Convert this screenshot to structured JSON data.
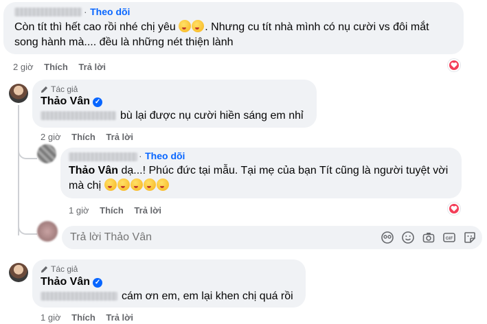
{
  "comment1": {
    "follow_label": "Theo dõi",
    "line1": "Còn tít thì hết cao rồi nhé chị yêu",
    "line1_tail": "Nhưng cu tít nhà mình có nụ cười vs đôi mắt",
    "line2": "song hành mà.... đều là những nét thiện lành",
    "time": "2 giờ",
    "like": "Thích",
    "reply": "Trả lời"
  },
  "comment2": {
    "author_badge": "Tác giả",
    "name": "Thảo Vân",
    "text": "bù lại được nụ cười hiền sáng em nhỉ",
    "time": "2 giờ",
    "like": "Thích",
    "reply": "Trả lời"
  },
  "comment3": {
    "follow_label": "Theo dõi",
    "mention": "Thảo Vân",
    "line1": "dạ...! Phúc đức tại mẫu. Tại mẹ của bạn Tít cũng là người tuyệt vời",
    "line2": "mà chị",
    "time": "1 giờ",
    "like": "Thích",
    "reply": "Trả lời"
  },
  "reply_box": {
    "placeholder": "Trả lời Thảo Vân",
    "icons": [
      "avatar-sticker-icon",
      "emoji-icon",
      "camera-icon",
      "gif-icon",
      "sticker-icon"
    ]
  },
  "comment4": {
    "author_badge": "Tác giả",
    "name": "Thảo Vân",
    "text": "cám ơn em, em lại khen chị quá rồi",
    "time": "1 giờ",
    "like": "Thích",
    "reply": "Trả lời"
  },
  "colors": {
    "bubble": "#f0f2f5",
    "link": "#0866ff",
    "meta": "#65676b",
    "love": "#f33e58"
  }
}
